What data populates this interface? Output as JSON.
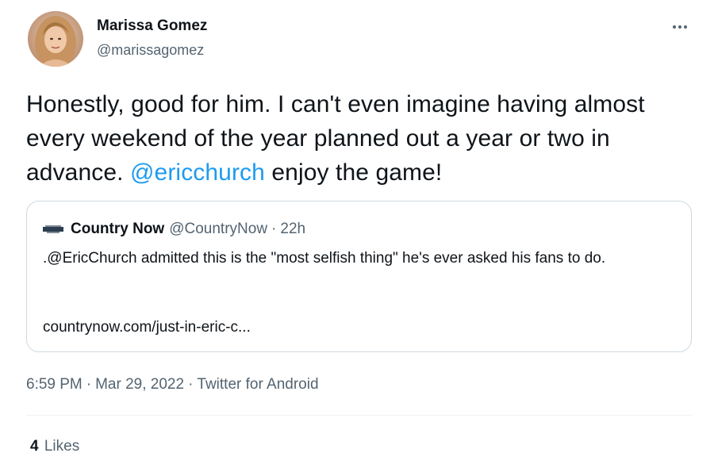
{
  "author": {
    "name": "Marissa Gomez",
    "handle": "@marissagomez"
  },
  "tweet": {
    "text_before_mention": "Honestly, good for him. I can't even imagine having almost every weekend of the year planned out a year or two in advance. ",
    "mention": "@ericchurch",
    "text_after_mention": " enjoy the game!"
  },
  "quote": {
    "name": "Country Now",
    "handle": "@CountryNow",
    "separator": "·",
    "time": "22h",
    "text": ".@EricChurch admitted this is the \"most selfish thing\" he's ever asked his fans to do.",
    "link": "countrynow.com/just-in-eric-c..."
  },
  "meta": {
    "time": "6:59 PM",
    "separator": "·",
    "date": "Mar 29, 2022",
    "source": "Twitter for Android"
  },
  "stats": {
    "likes_count": "4",
    "likes_label": "Likes"
  },
  "icons": {
    "more": "more-dots-icon",
    "quote_logo": "country-now-logo-icon"
  },
  "colors": {
    "accent": "#1d9bf0",
    "secondary_text": "#536471",
    "primary_text": "#0f1419",
    "border": "#cfd9de"
  }
}
